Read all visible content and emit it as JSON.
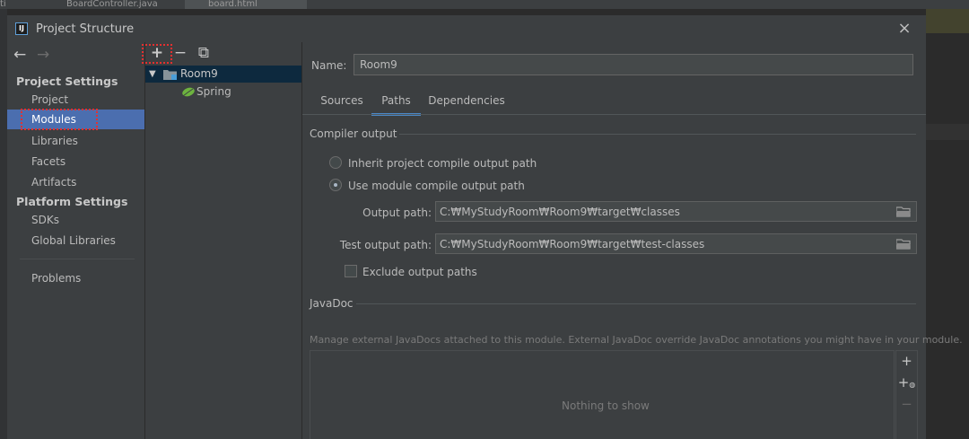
{
  "background_ide": {
    "tab1_text": "ti",
    "tab2_text": "BoardController.java",
    "tab3_text": "board.html"
  },
  "dialog": {
    "title": "Project Structure",
    "app_icon": "intellij-icon",
    "close_icon": "×"
  },
  "nav": {
    "back_icon": "←",
    "forward_icon": "→",
    "project_settings_header": "Project Settings",
    "project_settings_items": [
      {
        "label": "Project",
        "selected": false
      },
      {
        "label": "Modules",
        "selected": true
      },
      {
        "label": "Libraries",
        "selected": false
      },
      {
        "label": "Facets",
        "selected": false
      },
      {
        "label": "Artifacts",
        "selected": false
      }
    ],
    "platform_settings_header": "Platform Settings",
    "platform_settings_items": [
      {
        "label": "SDKs"
      },
      {
        "label": "Global Libraries"
      }
    ],
    "problems_label": "Problems"
  },
  "module_list": {
    "toolbar": {
      "add": "+",
      "remove": "−",
      "copy": "⧉"
    },
    "tree": {
      "module_name": "Room9",
      "children": [
        {
          "label": "Spring",
          "icon": "spring-leaf-icon"
        }
      ]
    }
  },
  "panel": {
    "name_label": "Name:",
    "name_value": "Room9",
    "tabs": [
      {
        "label": "Sources",
        "active": false
      },
      {
        "label": "Paths",
        "active": true
      },
      {
        "label": "Dependencies",
        "active": false
      }
    ],
    "compiler_output_title": "Compiler output",
    "radio_inherit": "Inherit project compile output path",
    "radio_use_module": "Use module compile output path",
    "selected_radio": "use_module",
    "output_path_label": "Output path:",
    "output_path_value": "C:₩MyStudyRoom₩Room9₩target₩classes",
    "test_output_path_label": "Test output path:",
    "test_output_path_value": "C:₩MyStudyRoom₩Room9₩target₩test-classes",
    "exclude_label": "Exclude output paths",
    "exclude_checked": false,
    "javadoc_title": "JavaDoc",
    "javadoc_desc": "Manage external JavaDocs attached to this module. External JavaDoc override JavaDoc annotations you might have in your module.",
    "javadoc_empty": "Nothing to show",
    "javadoc_toolbar": {
      "add": "+",
      "add_url": "+",
      "remove": "−"
    }
  },
  "colors": {
    "dialog_bg": "#3c3f41",
    "selection": "#4b6eaf",
    "tree_selection": "#0d293e",
    "tab_underline": "#4a88c7",
    "annotation_red": "#e53030"
  }
}
